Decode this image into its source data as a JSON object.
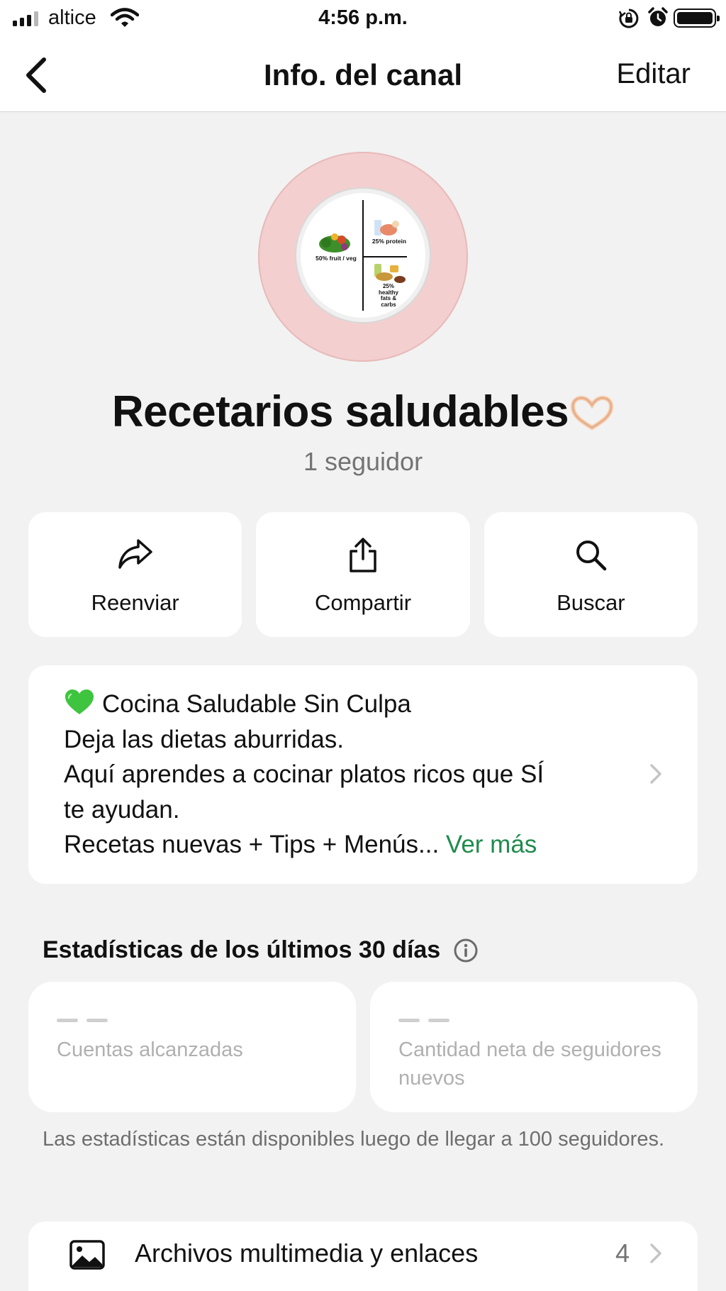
{
  "status_bar": {
    "carrier": "altice",
    "time": "4:56 p.m."
  },
  "nav": {
    "title": "Info. del canal",
    "edit_label": "Editar"
  },
  "avatar": {
    "plate_labels": {
      "fruit_veg": "50% fruit / veg",
      "protein": "25% protein",
      "fats_carbs": "25% healthy fats & carbs"
    }
  },
  "channel": {
    "name": "Recetarios saludables",
    "followers": "1 seguidor"
  },
  "actions": [
    {
      "label": "Reenviar",
      "icon": "forward-icon"
    },
    {
      "label": "Compartir",
      "icon": "share-icon"
    },
    {
      "label": "Buscar",
      "icon": "search-icon"
    }
  ],
  "description": {
    "line1": "Cocina Saludable Sin Culpa",
    "line2": "Deja las dietas aburridas.",
    "line3": "Aquí aprendes a cocinar platos ricos que SÍ",
    "line4": "te ayudan.",
    "line5": "Recetas nuevas + Tips + Menús...",
    "see_more": "Ver más"
  },
  "stats": {
    "title": "Estadísticas de los últimos 30 días",
    "cards": [
      {
        "value": "— —",
        "label": "Cuentas alcanzadas"
      },
      {
        "value": "— —",
        "label": "Cantidad neta de seguidores nuevos"
      }
    ],
    "note": "Las estadísticas están disponibles luego de llegar a 100 seguidores."
  },
  "media": {
    "label": "Archivos multimedia y enlaces",
    "count": "4"
  },
  "colors": {
    "accent_green": "#1f8b4c",
    "background": "#f2f2f2",
    "avatar_pink": "#f3cfcf"
  }
}
